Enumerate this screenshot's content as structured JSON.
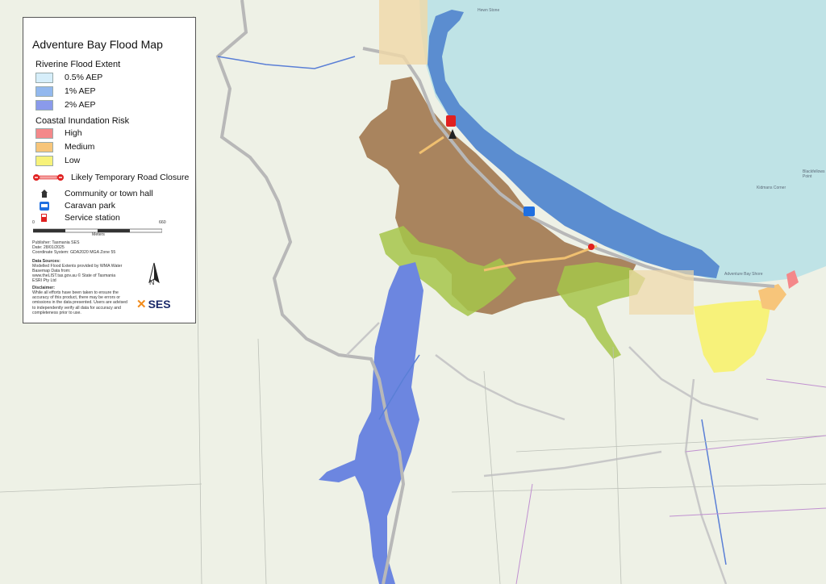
{
  "legend": {
    "title": "Adventure Bay Flood Map",
    "riverine": {
      "heading": "Riverine Flood Extent",
      "items": [
        {
          "label": "0.5% AEP",
          "color": "#d6eefa"
        },
        {
          "label": "1% AEP",
          "color": "#92b8ee"
        },
        {
          "label": "2% AEP",
          "color": "#8a9aeb"
        }
      ]
    },
    "coastal": {
      "heading": "Coastal Inundation Risk",
      "items": [
        {
          "label": "High",
          "color": "#f4888a"
        },
        {
          "label": "Medium",
          "color": "#f7c57a"
        },
        {
          "label": "Low",
          "color": "#f7f27a"
        }
      ]
    },
    "road_closure": "Likely Temporary Road Closure",
    "symbols": [
      {
        "label": "Community or town hall",
        "icon": "town-hall-icon"
      },
      {
        "label": "Caravan park",
        "icon": "caravan-icon"
      },
      {
        "label": "Service station",
        "icon": "fuel-pump-icon"
      }
    ],
    "scale": {
      "start": "0",
      "end": "660",
      "unit": "Meters"
    },
    "publisher": "Publisher:  Tasmania SES",
    "date": "Date:  28/01/2025",
    "crs": "Coordinate System: GDA2020 MGA Zone 55",
    "sources_heading": "Data Sources:",
    "sources_text": "Modelled Flood Extents provided by WMA Water",
    "basemap_text": "Basemap Data from:",
    "basemap_source": "www.theLIST.tas.gov.au © State of Tasmania",
    "esri": "ESRI Pty Ltd",
    "disclaimer_heading": "Disclaimer:",
    "disclaimer_text": "While all efforts have been taken to ensure the accuracy of this product, there may be errors or omissions in the data presented. Users are advised to independently verify all data for accuracy and completeness prior to use.",
    "north": "N",
    "logo": "SES"
  },
  "map_labels": {
    "hewn_stone": "Hewn Stone",
    "kidmans_corner": "Kidmans Corner",
    "blackfellow_point": "Blackfellows Point",
    "bay_shore": "Adventure Bay Shore"
  },
  "colors": {
    "sea": "#bfe3e6",
    "bay_water": "#5b8dd0",
    "land": "#eef1e6",
    "wetland": "#a9845e",
    "vegetation": "#a6c64a",
    "river_flood": "#6c86e0",
    "coastal_low": "#f7f27a"
  }
}
